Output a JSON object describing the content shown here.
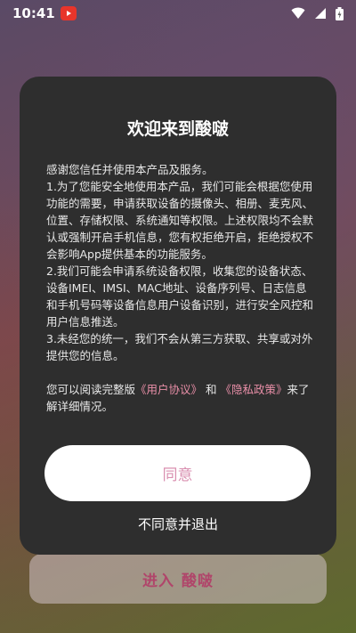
{
  "status_bar": {
    "time": "10:41",
    "icons": [
      "app-notification-icon",
      "wifi-icon",
      "signal-icon",
      "battery-icon"
    ]
  },
  "colors": {
    "dialog_bg": "#2e2e2e",
    "link": "#e98fa8",
    "agree_text": "#d98fb0",
    "enter_text": "#b0456a"
  },
  "background_button": {
    "label_part1": "进入",
    "label_part2": "酸啵"
  },
  "dialog": {
    "title": "欢迎来到酸啵",
    "intro": "感谢您信任并使用本产品及服务。",
    "item1": "1.为了您能安全地使用本产品，我们可能会根据您使用功能的需要，申请获取设备的摄像头、相册、麦克风、位置、存储权限、系统通知等权限。上述权限均不会默认或强制开启手机信息，您有权拒绝开启，拒绝授权不会影响App提供基本的功能服务。",
    "item2": "2.我们可能会申请系统设备权限，收集您的设备状态、设备IMEI、IMSI、MAC地址、设备序列号、日志信息和手机号码等设备信息用户设备识别，进行安全风控和用户信息推送。",
    "item3": "3.未经您的统一，我们不会从第三方获取、共享或对外提供您的信息。",
    "read_prefix": "您可以阅读完整版",
    "user_agreement": "《用户协议》",
    "read_and": "和",
    "privacy_policy": "《隐私政策》",
    "read_suffix": "来了解详细情况。",
    "agree_label": "同意",
    "decline_label": "不同意并退出"
  }
}
